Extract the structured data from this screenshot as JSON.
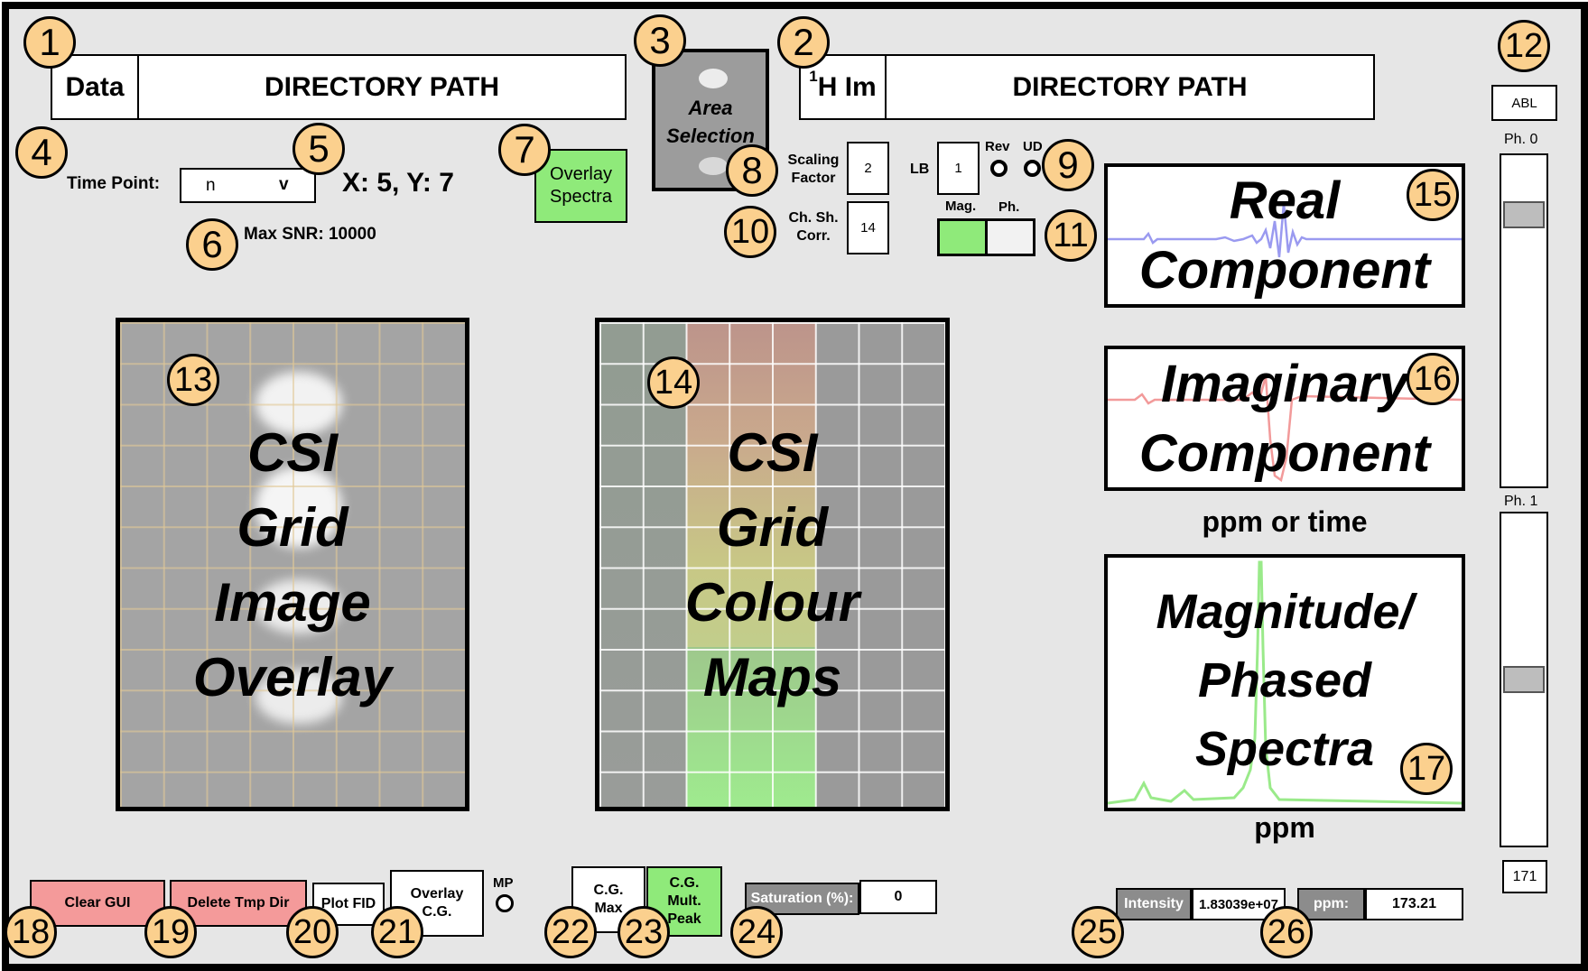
{
  "data_row": {
    "label": "Data",
    "path": "DIRECTORY PATH"
  },
  "h1_row": {
    "label_sup": "1",
    "label_main": "H Im",
    "path": "DIRECTORY PATH"
  },
  "area_selection": {
    "line1": "Area",
    "line2": "Selection"
  },
  "time_point": {
    "label": "Time Point:",
    "value": "n",
    "arrow": "v"
  },
  "coords": "X: 5, Y: 7",
  "max_snr": "Max SNR: 10000",
  "overlay_spectra": {
    "line1": "Overlay",
    "line2": "Spectra"
  },
  "scaling_factor": {
    "label1": "Scaling",
    "label2": "Factor",
    "value": "2"
  },
  "ch_sh_corr": {
    "label1": "Ch. Sh.",
    "label2": "Corr.",
    "value": "14"
  },
  "lb": {
    "label": "LB",
    "value": "1"
  },
  "rev_label": "Rev",
  "ud_label": "UD",
  "mag_label": "Mag.",
  "ph_label": "Ph.",
  "abl_label": "ABL",
  "ph0_label": "Ph. 0",
  "ph1_label": "Ph. 1",
  "ph0_level": 0.15,
  "ph1_level": 0.5,
  "ph1_value": "171",
  "grid_image": {
    "line1": "CSI",
    "line2": "Grid",
    "line3": "Image",
    "line4": "Overlay"
  },
  "grid_colour": {
    "line1": "CSI",
    "line2": "Grid",
    "line3": "Colour",
    "line4": "Maps"
  },
  "real_panel": {
    "line1": "Real",
    "line2": "Component"
  },
  "imag_panel": {
    "line1": "Imaginary",
    "line2": "Component"
  },
  "ppm_or_time": "ppm or time",
  "spectra_panel": {
    "line1": "Magnitude/",
    "line2": "Phased",
    "line3": "Spectra"
  },
  "ppm_axis": "ppm",
  "buttons": {
    "clear_gui": "Clear GUI",
    "delete_tmp": "Delete Tmp Dir",
    "plot_fid": "Plot FID",
    "overlay_cg_1": "Overlay",
    "overlay_cg_2": "C.G.",
    "mp": "MP",
    "cg_max_1": "C.G.",
    "cg_max_2": "Max",
    "cg_mult_1": "C.G.",
    "cg_mult_2": "Mult.",
    "cg_mult_3": "Peak"
  },
  "saturation": {
    "label": "Saturation (%):",
    "value": "0"
  },
  "intensity": {
    "label": "Intensity",
    "value": "1.83039e+07"
  },
  "ppm_readout": {
    "label": "ppm:",
    "value": "173.21"
  },
  "badges": [
    "1",
    "2",
    "3",
    "4",
    "5",
    "6",
    "7",
    "8",
    "9",
    "10",
    "11",
    "12",
    "13",
    "14",
    "15",
    "16",
    "17",
    "18",
    "19",
    "20",
    "21",
    "22",
    "23",
    "24",
    "25",
    "26"
  ],
  "colors": {
    "badge": "#fbd08e",
    "green_button": "#8fea7a",
    "red_button": "#f49a9a",
    "real_line": "#9a9af0",
    "imag_line": "#f29a9a",
    "mag_line": "#9aea8a",
    "background": "#e6e6e6"
  }
}
